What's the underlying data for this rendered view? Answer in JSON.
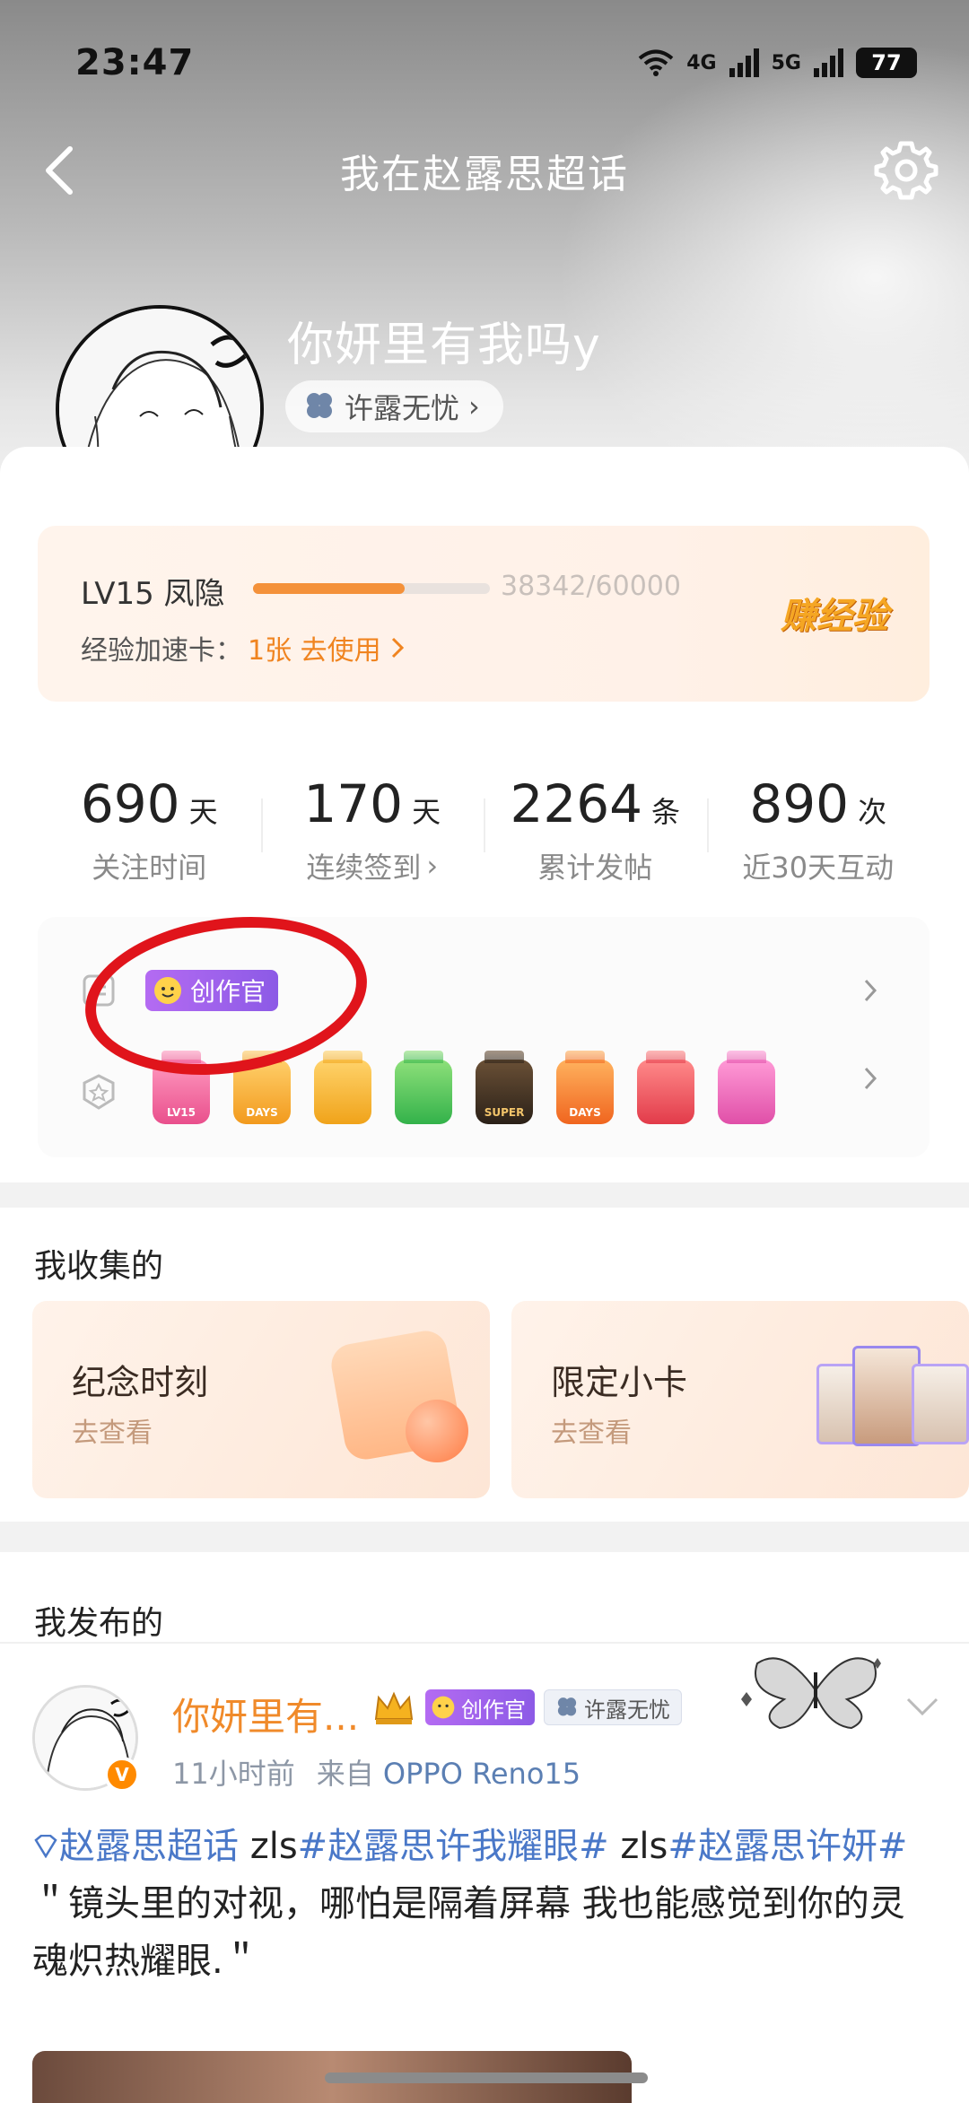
{
  "status_bar": {
    "time": "23:47",
    "net1": "4G",
    "net2": "5G",
    "battery": "77"
  },
  "header": {
    "title": "我在赵露思超话"
  },
  "profile": {
    "name": "你妍里有我吗y",
    "verified_mark": "V",
    "fan_tag": "许露无忧",
    "fan_tag_arrow": "›"
  },
  "level": {
    "label": "LV15 凤隐",
    "progress": 0.639,
    "count": "38342/60000",
    "boost_label": "经验加速卡：",
    "boost_value": "1张 去使用",
    "earn_label": "赚经验"
  },
  "stats": [
    {
      "value": "690",
      "unit": "天",
      "label": "关注时间",
      "chevron": ""
    },
    {
      "value": "170",
      "unit": "天",
      "label": "连续签到",
      "chevron": "›"
    },
    {
      "value": "2264",
      "unit": "条",
      "label": "累计发帖",
      "chevron": ""
    },
    {
      "value": "890",
      "unit": "次",
      "label": "近30天互动",
      "chevron": ""
    }
  ],
  "title_badge": {
    "label": "创作官"
  },
  "medals": [
    {
      "text": "LV15",
      "color": "pink"
    },
    {
      "text": "DAYS",
      "color": "orange"
    },
    {
      "text": "",
      "color": "gold"
    },
    {
      "text": "",
      "color": "green"
    },
    {
      "text": "SUPER",
      "color": "black"
    },
    {
      "text": "DAYS",
      "color": "red"
    },
    {
      "text": "",
      "color": "rose"
    },
    {
      "text": "",
      "color": "magenta"
    }
  ],
  "collected": {
    "title": "我收集的",
    "cards": [
      {
        "title": "纪念时刻",
        "sub": "去查看"
      },
      {
        "title": "限定小卡",
        "sub": "去查看"
      }
    ]
  },
  "posts": {
    "title": "我发布的",
    "author": "你妍里有...",
    "title_chip": "创作官",
    "fan_chip": "许露无忧",
    "time": "11小时前",
    "source": "来自",
    "device": "OPPO Reno15",
    "body_tag1": "赵露思超话",
    "body_mid1": " zls",
    "body_tag2": "#赵露思许我耀眼#",
    "body_mid2": " zls",
    "body_tag3": "#赵露思许妍#",
    "body_quote": "＂镜头里的对视，哪怕是隔着屏幕 我也能感觉到你的灵魂炽热耀眼.＂"
  }
}
